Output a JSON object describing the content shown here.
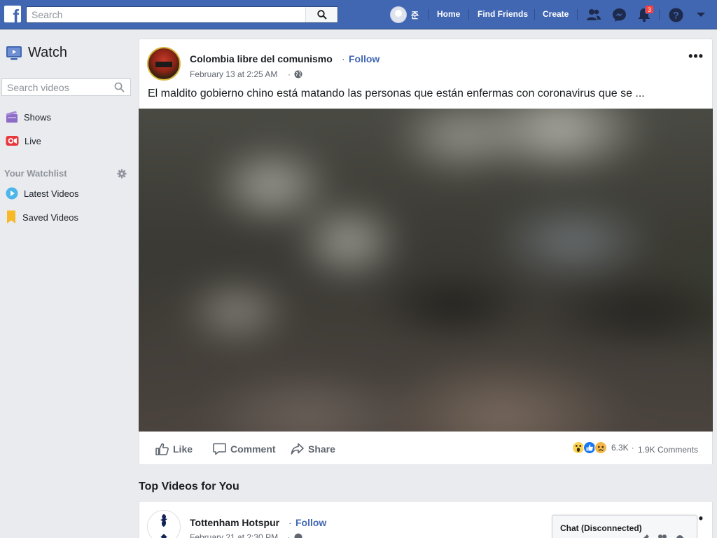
{
  "topbar": {
    "logo_letter": "f",
    "search_placeholder": "Search",
    "user_name": "준",
    "nav": [
      "Home",
      "Find Friends",
      "Create"
    ],
    "notification_count": "3",
    "icons": [
      "friends-icon",
      "messenger-icon",
      "notifications-icon",
      "help-icon",
      "account-menu-icon"
    ]
  },
  "sidebar": {
    "title": "Watch",
    "search_placeholder": "Search videos",
    "items": [
      {
        "label": "Shows",
        "icon": "shows-icon"
      },
      {
        "label": "Live",
        "icon": "live-icon"
      }
    ],
    "watchlist_heading": "Your Watchlist",
    "watchlist_items": [
      {
        "label": "Latest Videos",
        "icon": "play-icon"
      },
      {
        "label": "Saved Videos",
        "icon": "bookmark-icon"
      }
    ]
  },
  "post": {
    "page_name": "Colombia libre del comunismo",
    "separator": "·",
    "follow": "Follow",
    "date": "February 13 at 2:25 AM",
    "date_sep": "·",
    "more": "•••",
    "text": "El maldito gobierno chino está matando las personas que están enfermas con coronavirus que se ...",
    "actions": {
      "like": "Like",
      "comment": "Comment",
      "share": "Share"
    },
    "reaction_count": "6.3K",
    "reaction_sep": "·",
    "comments": "1.9K Comments"
  },
  "section_title": "Top Videos for You",
  "post2": {
    "page_name": "Tottenham Hotspur",
    "separator": "·",
    "follow": "Follow",
    "date": "February 21 at 2:30 PM",
    "date_sep": "·"
  },
  "chat": {
    "label": "Chat (Disconnected)"
  },
  "colors": {
    "brand": "#4267b2",
    "link": "#4267b2",
    "background": "#e9ebee"
  }
}
